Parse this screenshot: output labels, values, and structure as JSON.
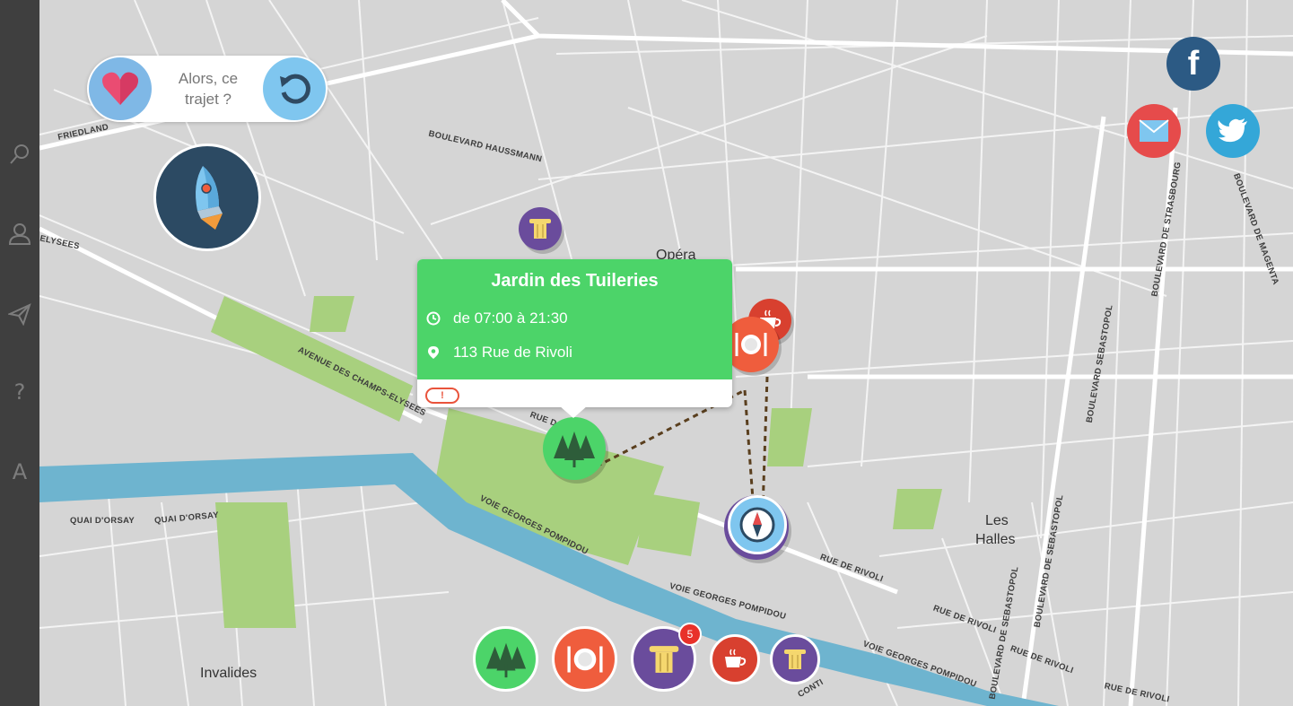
{
  "sidebar": {
    "items": [
      {
        "name": "search-icon",
        "glyph": "⚲"
      },
      {
        "name": "user-icon",
        "glyph": "👤"
      },
      {
        "name": "send-icon",
        "glyph": "➤"
      },
      {
        "name": "help-icon",
        "glyph": "?"
      },
      {
        "name": "font-icon",
        "glyph": "A"
      }
    ]
  },
  "topbar": {
    "question_line1": "Alors, ce",
    "question_line2": "trajet ?"
  },
  "popup": {
    "title": "Jardin des Tuileries",
    "hours": "de 07:00 à 21:30",
    "address": "113 Rue de Rivoli",
    "warning": "!"
  },
  "map_labels": {
    "friedland": "FRIEDLAND",
    "haussmann": "BOULEVARD HAUSSMANN",
    "elysees": "ELYSEES",
    "champs": "AVENUE DES CHAMPS-ELYSEES",
    "opera": "Opéra",
    "rue_de_rivoli_1": "RUE DE RIVOLI",
    "rue_de_rivoli_2": "RUE DE RIVOLI",
    "rue_de_rivoli_3": "RUE DE RIVOLI",
    "rue_de_rivoli_4": "RUE DE RIVOLI",
    "rue_de_rivoli_5": "RUE DE RIVOLI",
    "rue_d": "RUE D",
    "quai_orsay_1": "QUAI D'ORSAY",
    "quai_orsay_2": "QUAI D'ORSAY",
    "georges_pompidou_1": "VOIE GEORGES POMPIDOU",
    "georges_pompidou_2": "VOIE GEORGES POMPIDOU",
    "georges_pompidou_3": "VOIE GEORGES POMPIDOU",
    "les_halles_1": "Les",
    "les_halles_2": "Halles",
    "invalides": "Invalides",
    "strasbourg": "BOULEVARD DE STRASBOURG",
    "sebastopol_1": "BOULEVARD SEBASTOPOL",
    "sebastopol_2": "BOULEVARD DE SEBASTOPOL",
    "sebastopol_3": "BOULEVARD DE SEBASTOPOL",
    "magenta": "BOULEVARD DE MAGENTA",
    "conti": "CONTI"
  },
  "categories": [
    {
      "name": "park",
      "color": "#4cd469"
    },
    {
      "name": "restaurant",
      "color": "#ef5d3d"
    },
    {
      "name": "monument",
      "color": "#6a4c9c",
      "count": "5"
    },
    {
      "name": "cafe",
      "color": "#d8402f"
    },
    {
      "name": "museum",
      "color": "#6a4c9c"
    }
  ],
  "social": [
    "facebook",
    "email",
    "twitter"
  ],
  "colors": {
    "sidebar": "#3f3f3f",
    "water": "#6eb4cf",
    "park": "#a8d07e",
    "popup": "#4cd469",
    "route": "#5a3f1e"
  }
}
